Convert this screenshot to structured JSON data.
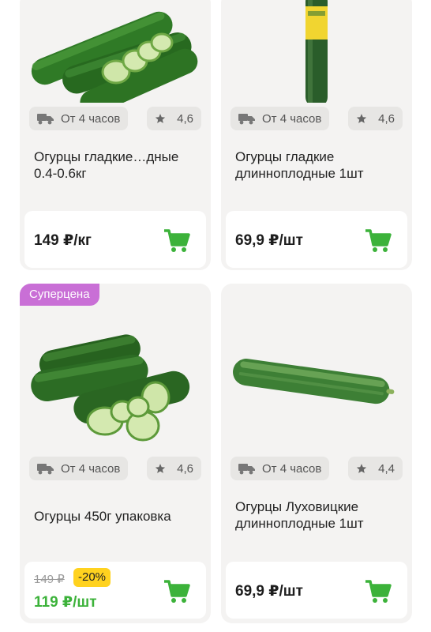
{
  "cards": [
    {
      "delivery": "От 4 часов",
      "rating": "4,6",
      "title_line1": "Огурцы гладкие…дные",
      "title_line2": "0.4-0.6кг",
      "price": "149 ₽/кг"
    },
    {
      "delivery": "От 4 часов",
      "rating": "4,6",
      "title_line1": "Огурцы гладкие",
      "title_line2": "длинноплодные 1шт",
      "price": "69,9 ₽/шт"
    },
    {
      "badge": "Суперцена",
      "delivery": "От 4 часов",
      "rating": "4,6",
      "title_line1": "Огурцы 450г упаковка",
      "old_price": "149 ₽",
      "discount": "-20%",
      "price": "119 ₽/шт"
    },
    {
      "delivery": "От 4 часов",
      "rating": "4,4",
      "title_line1": "Огурцы Луховицкие",
      "title_line2": "длинноплодные 1шт",
      "price": "69,9 ₽/шт"
    }
  ],
  "colors": {
    "accent_green": "#3cb23a",
    "badge_purple": "#c96fd6",
    "discount_yellow": "#ffd21f",
    "card_bg": "#f4f3f2"
  },
  "icons": [
    "truck-icon",
    "star-icon",
    "cart-icon"
  ]
}
